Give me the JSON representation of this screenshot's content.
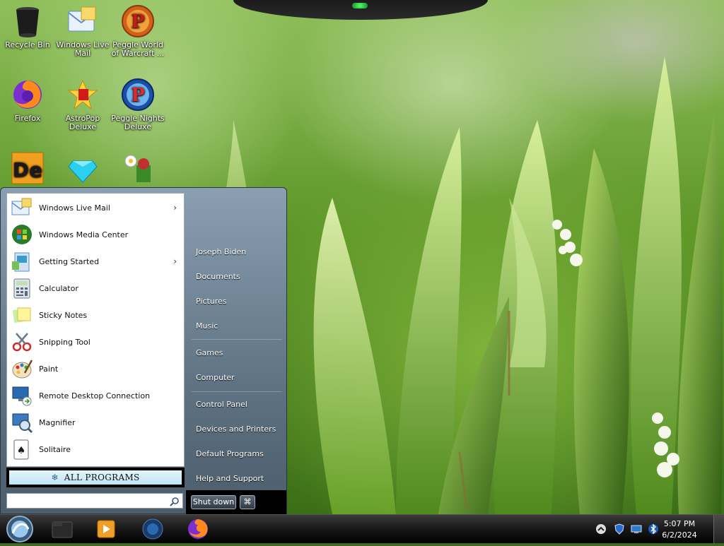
{
  "desktop": {
    "icons": [
      {
        "label": "Recycle Bin",
        "icon": "recycle-bin-icon"
      },
      {
        "label": "Windows Live Mail",
        "icon": "windows-live-mail-icon"
      },
      {
        "label": "Peggle World of Warcraft ...",
        "icon": "peggle-wow-icon"
      },
      {
        "label": "Firefox",
        "icon": "firefox-icon"
      },
      {
        "label": "AstroPop Deluxe",
        "icon": "astropop-icon"
      },
      {
        "label": "Peggle Nights Deluxe",
        "icon": "peggle-nights-icon"
      },
      {
        "label": "",
        "icon": "de-app-icon"
      },
      {
        "label": "",
        "icon": "bejeweled-gem-icon"
      },
      {
        "label": "",
        "icon": "plants-game-icon"
      }
    ]
  },
  "start_menu": {
    "programs": [
      {
        "label": "Windows Live Mail",
        "icon": "windows-live-mail-icon",
        "has_submenu": true
      },
      {
        "label": "Windows Media Center",
        "icon": "windows-media-center-icon",
        "has_submenu": false
      },
      {
        "label": "Getting Started",
        "icon": "getting-started-icon",
        "has_submenu": true
      },
      {
        "label": "Calculator",
        "icon": "calculator-icon",
        "has_submenu": false
      },
      {
        "label": "Sticky Notes",
        "icon": "sticky-notes-icon",
        "has_submenu": false
      },
      {
        "label": "Snipping Tool",
        "icon": "snipping-tool-icon",
        "has_submenu": false
      },
      {
        "label": "Paint",
        "icon": "paint-icon",
        "has_submenu": false
      },
      {
        "label": "Remote Desktop Connection",
        "icon": "remote-desktop-icon",
        "has_submenu": false
      },
      {
        "label": "Magnifier",
        "icon": "magnifier-icon",
        "has_submenu": false
      },
      {
        "label": "Solitaire",
        "icon": "solitaire-icon",
        "has_submenu": false
      }
    ],
    "submenu_arrow": "›",
    "all_programs_label": "ALL PROGRAMS",
    "search_placeholder": "",
    "right_items": [
      "Joseph Biden",
      "Documents",
      "Pictures",
      "Music",
      "Games",
      "Computer",
      "Control Panel",
      "Devices and Printers",
      "Default Programs",
      "Help and Support"
    ],
    "shutdown_label": "Shut down",
    "lock_glyph": "⌘"
  },
  "taskbar": {
    "pinned": [
      "start-orb-icon",
      "explorer-icon",
      "media-player-icon",
      "windows-media-center-icon",
      "firefox-icon"
    ],
    "tray": [
      "show-hidden-icons-icon",
      "security-shield-icon",
      "network-icon",
      "bluetooth-icon"
    ],
    "time": "5:07 PM",
    "date": "6/2/2024"
  },
  "colors": {
    "menu_left_bg": "#ffffff",
    "menu_right_bg": "#6b7f90",
    "taskbar_bg": "#111111",
    "accent_green": "#4dff6a"
  }
}
